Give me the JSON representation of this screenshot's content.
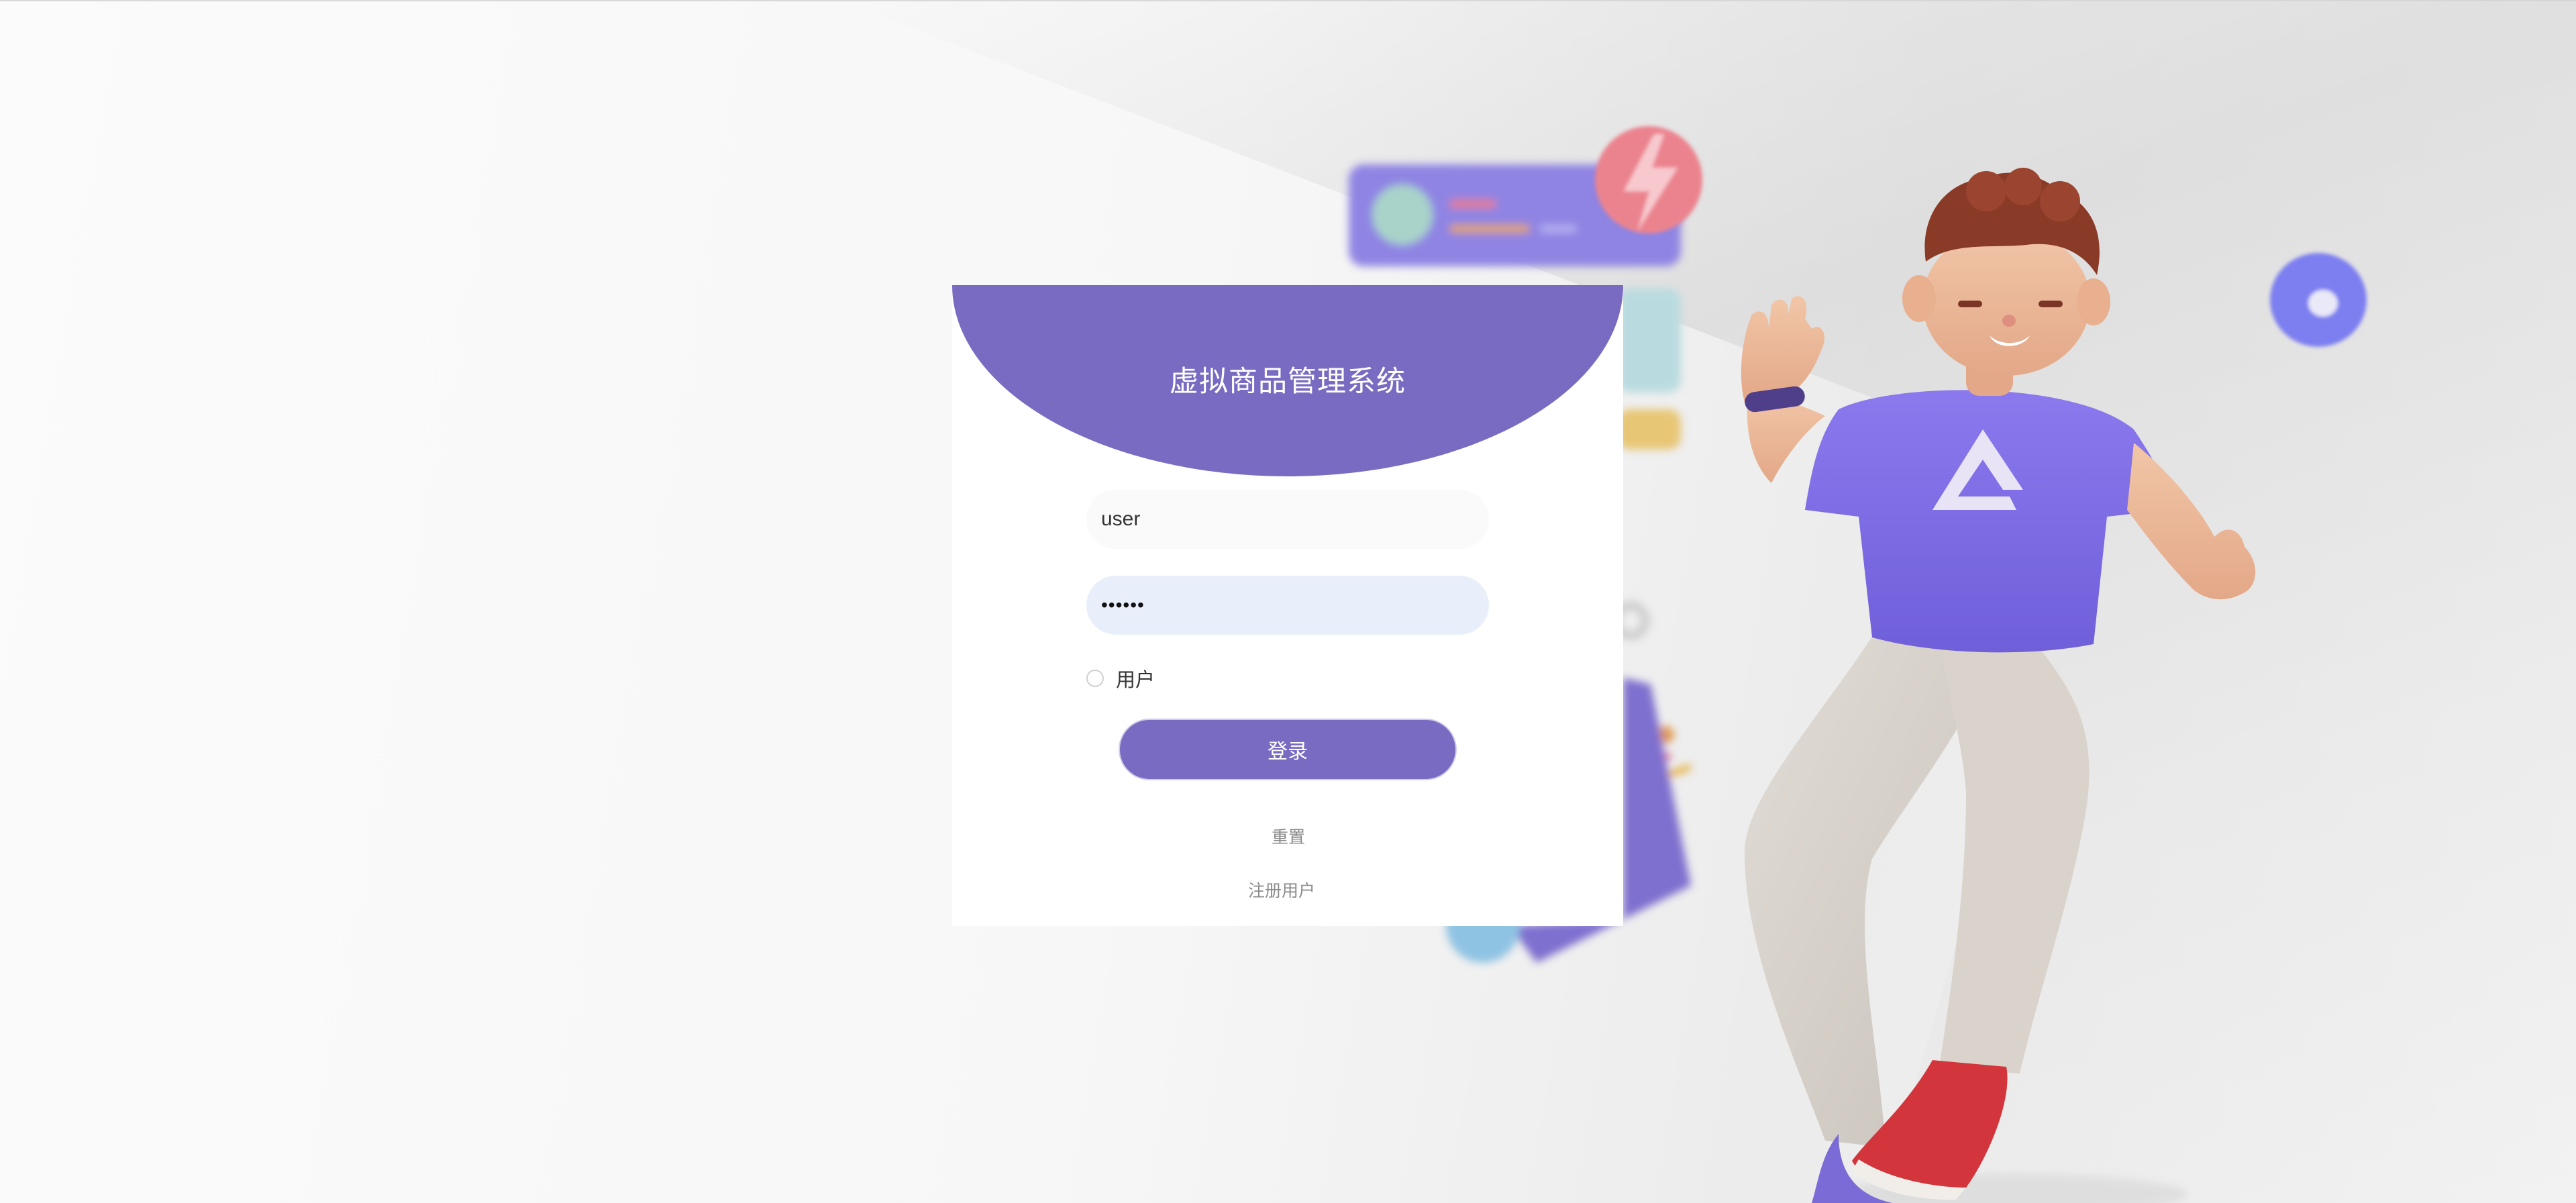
{
  "login": {
    "title": "虚拟商品管理系统",
    "username_value": "user",
    "password_mask": "••••••",
    "role_option": "用户",
    "login_button": "登录",
    "reset_link": "重置",
    "register_link": "注册用户"
  },
  "colors": {
    "accent": "#7a6bc2",
    "password_field_bg": "#e8effb",
    "username_field_bg": "#fafafa"
  },
  "illustration": {
    "icons": [
      "lightning-bubble-icon",
      "donut-icon",
      "avatar-character"
    ]
  }
}
